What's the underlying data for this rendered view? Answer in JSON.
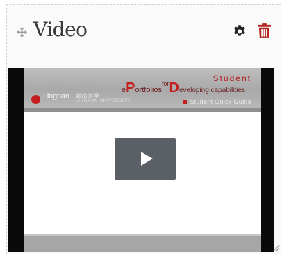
{
  "block": {
    "title": "Video",
    "icons": {
      "move": "move-arrows-icon",
      "settings": "gear-icon",
      "delete": "trash-icon",
      "resize": "resize-grip-icon"
    }
  },
  "video": {
    "logo": {
      "name": "Lingnan",
      "chinese": "嶺南大學",
      "motto": "LINGNAN UNIVERSITY"
    },
    "eportfolio": {
      "prefix_e": "e",
      "big_p": "P",
      "ortfolios": "ortfolios",
      "for": "for",
      "big_d": "D",
      "eveloping": "eveloping capabilities",
      "student": "Student"
    },
    "subtitle": "Student Quick Guide",
    "play_icon": "play-icon"
  },
  "colors": {
    "accent_red": "#c41f1f",
    "play_bg": "#5b5f66",
    "header_text": "#3a3a3a"
  }
}
